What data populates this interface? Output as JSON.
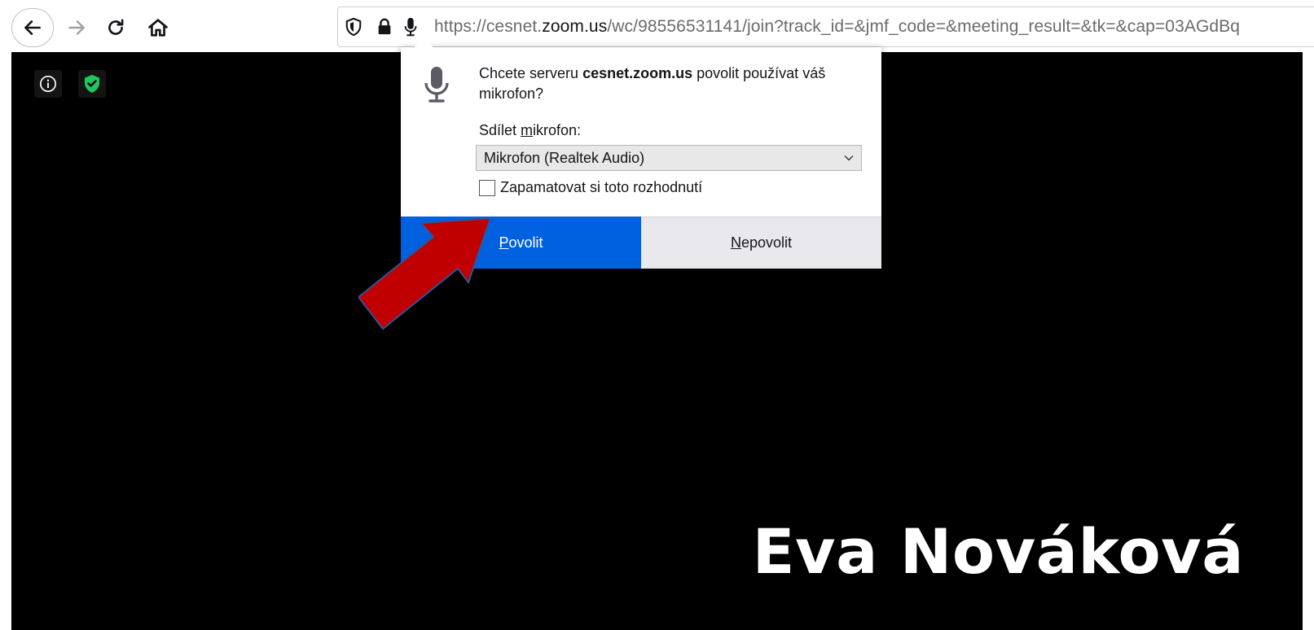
{
  "toolbar": {
    "url_prefix": "https://cesnet.",
    "url_domain": "zoom.us",
    "url_path": "/wc/98556531141/join?track_id=&jmf_code=&meeting_result=&tk=&cap=03AGdBq"
  },
  "popup": {
    "message_prefix": "Chcete serveru ",
    "message_host": "cesnet.zoom.us",
    "message_suffix": " povolit používat váš mikrofon?",
    "share_label_prefix": "Sdílet ",
    "share_label_accel": "m",
    "share_label_suffix": "ikrofon:",
    "selected_device": "Mikrofon (Realtek Audio)",
    "remember_label": "Zapamatovat si toto rozhodnutí",
    "remember_checked": false,
    "allow_accel": "P",
    "allow_rest": "ovolit",
    "deny_accel": "N",
    "deny_rest": "epovolit"
  },
  "meeting": {
    "participant_name": "Eva Nováková"
  },
  "colors": {
    "allow_button": "#0061e0",
    "deny_button": "#e9e9ed",
    "shield_green": "#22c55e",
    "arrow_red": "#c00000",
    "arrow_outline": "#2f5597"
  },
  "icons": {
    "back": "arrow-left-icon",
    "forward": "arrow-right-icon",
    "reload": "reload-icon",
    "home": "home-icon",
    "tracking": "shield-icon",
    "lock": "lock-icon",
    "mic": "microphone-icon",
    "info": "info-icon",
    "encryption": "shield-check-icon"
  }
}
